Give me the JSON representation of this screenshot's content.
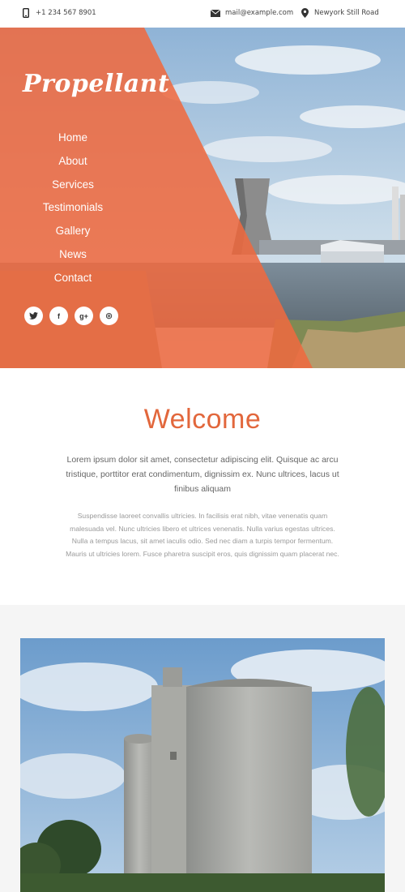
{
  "topbar": {
    "phone": "+1 234 567 8901",
    "email": "mail@example.com",
    "address": "Newyork Still Road",
    "icons": [
      "phone-icon",
      "envelope-icon",
      "map-pin-icon"
    ]
  },
  "brand": {
    "logo": "Propellant"
  },
  "nav": {
    "items": [
      {
        "label": "Home"
      },
      {
        "label": "About"
      },
      {
        "label": "Services"
      },
      {
        "label": "Testimonials"
      },
      {
        "label": "Gallery"
      },
      {
        "label": "News"
      },
      {
        "label": "Contact"
      }
    ]
  },
  "social": {
    "twitter": "t",
    "facebook": "f",
    "googleplus": "g+",
    "dribbble": "◎"
  },
  "welcome": {
    "title": "Welcome",
    "lead": "Lorem ipsum dolor sit amet, consectetur adipiscing elit. Quisque ac arcu tristique, porttitor erat condimentum, dignissim ex. Nunc ultrices, lacus ut finibus aliquam",
    "body": "Suspendisse laoreet convallis ultricies. In facilisis erat nibh, vitae venenatis quam malesuada vel. Nunc ultricies libero et ultrices venenatis. Nulla varius egestas ultrices. Nulla a tempus lacus, sit amet iaculis odio. Sed nec diam a turpis tempor fermentum. Mauris ut ultricies lorem. Fusce pharetra suscipit eros, quis dignissim quam placerat nec."
  },
  "colors": {
    "accent": "#e2673c",
    "overlay": "#ef6a3f",
    "sky": "#b9d1e6",
    "gray_bg": "#f5f5f5"
  }
}
